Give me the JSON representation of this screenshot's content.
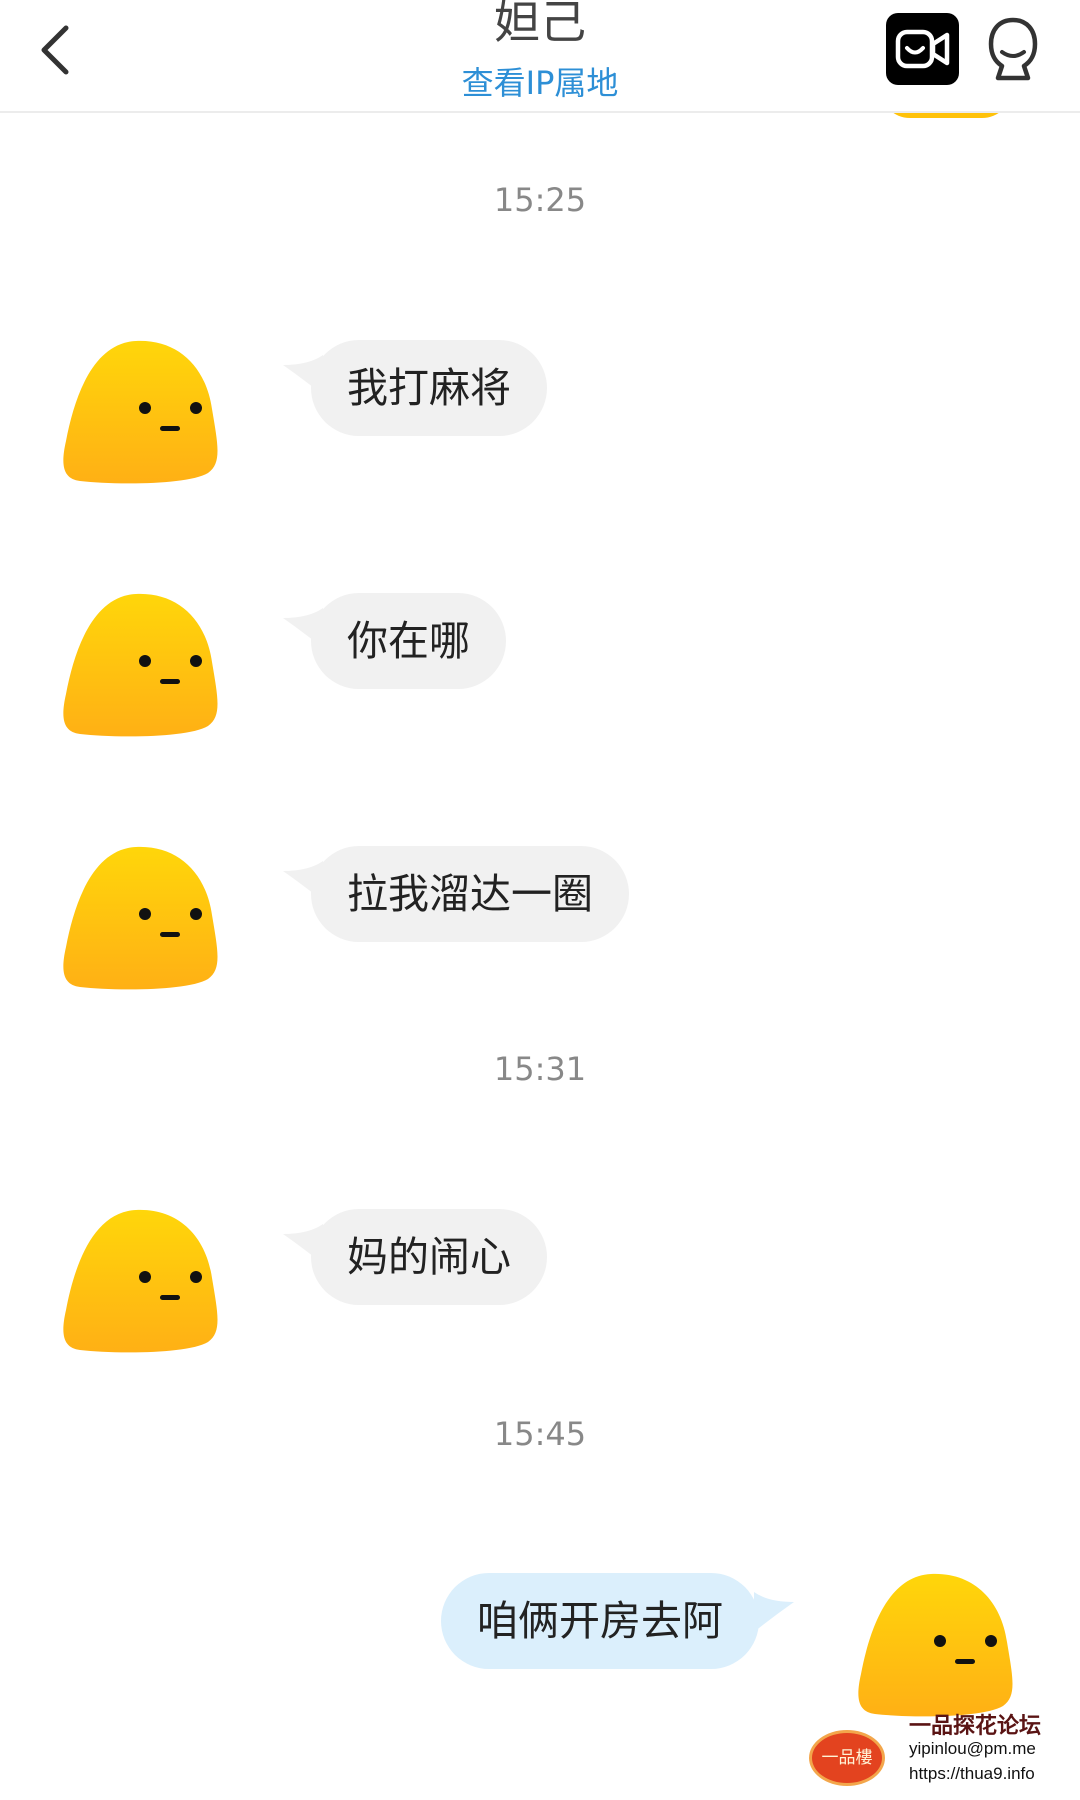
{
  "header": {
    "title": "妲己",
    "ip_link": "查看IP属地",
    "back_icon": "chevron-left-icon",
    "video_icon": "video-camera-icon",
    "profile_icon": "person-icon"
  },
  "chat": {
    "time_1": "15:25",
    "msg_1": "我打麻将",
    "msg_2": "你在哪",
    "msg_3": "拉我溜达一圈",
    "time_2": "15:31",
    "msg_4": "妈的闹心",
    "time_3": "15:45",
    "msg_5": "咱俩开房去阿"
  },
  "watermark": {
    "logo_text": "一品樓",
    "title": "一品探花论坛",
    "email": "yipinlou@pm.me",
    "url": "https://thua9.info"
  },
  "colors": {
    "accent_link": "#2d8fd6",
    "incoming_bubble": "#f1f1f1",
    "outgoing_bubble": "#dbeffc",
    "avatar_top": "#ffd40c",
    "avatar_bottom": "#ffb212"
  }
}
